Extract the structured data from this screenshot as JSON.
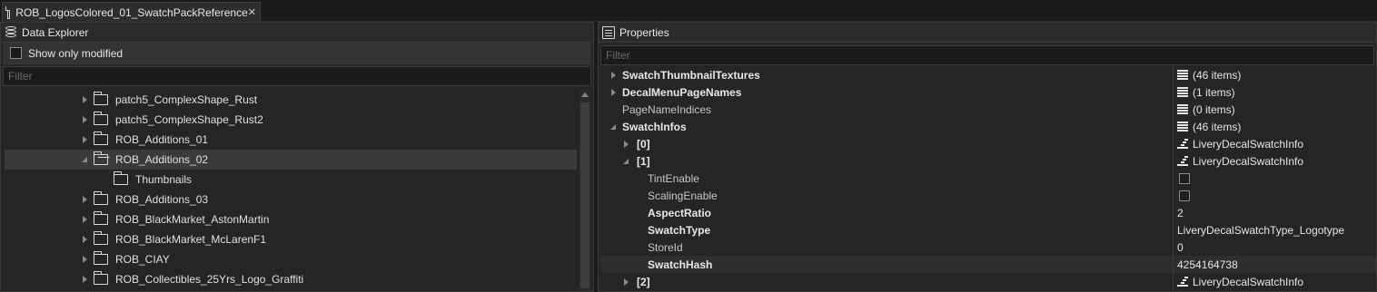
{
  "tab": {
    "title": "ROB_LogosColored_01_SwatchPackReference",
    "close": "✕"
  },
  "explorer": {
    "title": "Data Explorer",
    "show_modified_label": "Show only modified",
    "filter_placeholder": "Filter",
    "items": [
      {
        "label": "patch5_ComplexShape_Rust",
        "expanded": false
      },
      {
        "label": "patch5_ComplexShape_Rust2",
        "expanded": false
      },
      {
        "label": "ROB_Additions_01",
        "expanded": false
      },
      {
        "label": "ROB_Additions_02",
        "expanded": true,
        "selected": true
      },
      {
        "label": "Thumbnails",
        "child": true
      },
      {
        "label": "ROB_Additions_03",
        "expanded": false
      },
      {
        "label": "ROB_BlackMarket_AstonMartin",
        "expanded": false
      },
      {
        "label": "ROB_BlackMarket_McLarenF1",
        "expanded": false
      },
      {
        "label": "ROB_CIAY",
        "expanded": false
      },
      {
        "label": "ROB_Collectibles_25Yrs_Logo_Graffiti",
        "expanded": false
      }
    ]
  },
  "properties": {
    "title": "Properties",
    "filter_placeholder": "Filter",
    "rows": [
      {
        "name": "SwatchThumbnailTextures",
        "value": "(46 items)",
        "bold": true,
        "level": 0,
        "arrow": "collapsed",
        "icon": "list"
      },
      {
        "name": "DecalMenuPageNames",
        "value": "(1 items)",
        "bold": true,
        "level": 0,
        "arrow": "collapsed",
        "icon": "list"
      },
      {
        "name": "PageNameIndices",
        "value": "(0 items)",
        "bold": false,
        "level": 0,
        "arrow": "none",
        "icon": "list"
      },
      {
        "name": "SwatchInfos",
        "value": "(46 items)",
        "bold": true,
        "level": 0,
        "arrow": "expanded",
        "icon": "list"
      },
      {
        "name": "[0]",
        "value": "LiveryDecalSwatchInfo",
        "bold": true,
        "level": 1,
        "arrow": "collapsed",
        "icon": "object"
      },
      {
        "name": "[1]",
        "value": "LiveryDecalSwatchInfo",
        "bold": true,
        "level": 1,
        "arrow": "expanded",
        "icon": "object"
      },
      {
        "name": "TintEnable",
        "value": "",
        "bold": false,
        "level": 2,
        "arrow": "none",
        "icon": "checkbox"
      },
      {
        "name": "ScalingEnable",
        "value": "",
        "bold": false,
        "level": 2,
        "arrow": "none",
        "icon": "checkbox"
      },
      {
        "name": "AspectRatio",
        "value": "2",
        "bold": true,
        "level": 2,
        "arrow": "none",
        "icon": "none"
      },
      {
        "name": "SwatchType",
        "value": "LiveryDecalSwatchType_Logotype",
        "bold": true,
        "level": 2,
        "arrow": "none",
        "icon": "none"
      },
      {
        "name": "StoreId",
        "value": "0",
        "bold": false,
        "level": 2,
        "arrow": "none",
        "icon": "none"
      },
      {
        "name": "SwatchHash",
        "value": "4254164738",
        "bold": true,
        "level": 2,
        "arrow": "none",
        "icon": "none",
        "highlight": true
      },
      {
        "name": "[2]",
        "value": "LiveryDecalSwatchInfo",
        "bold": true,
        "level": 1,
        "arrow": "collapsed",
        "icon": "object"
      }
    ]
  }
}
